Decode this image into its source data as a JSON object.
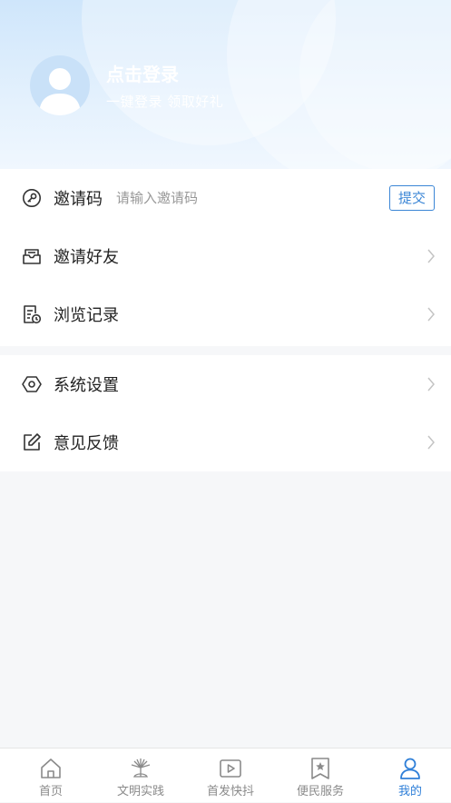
{
  "header": {
    "login_title": "点击登录",
    "login_subtitle": "一键登录 领取好礼",
    "avatar_icon": "user-avatar-icon"
  },
  "menu_section_1": {
    "invite_code": {
      "label": "邀请码",
      "placeholder": "请输入邀请码",
      "value": "",
      "submit_label": "提交",
      "icon": "key-icon"
    },
    "items": [
      {
        "label": "邀请好友",
        "icon": "inbox-icon"
      },
      {
        "label": "浏览记录",
        "icon": "history-icon"
      }
    ]
  },
  "menu_section_2": {
    "items": [
      {
        "label": "系统设置",
        "icon": "settings-hexagon-icon"
      },
      {
        "label": "意见反馈",
        "icon": "edit-icon"
      }
    ]
  },
  "tabbar": {
    "tabs": [
      {
        "label": "首页",
        "icon": "home-icon",
        "active": false
      },
      {
        "label": "文明实践",
        "icon": "emblem-icon",
        "active": false
      },
      {
        "label": "首发快抖",
        "icon": "video-play-icon",
        "active": false
      },
      {
        "label": "便民服务",
        "icon": "star-badge-icon",
        "active": false
      },
      {
        "label": "我的",
        "icon": "user-icon",
        "active": true
      }
    ]
  },
  "colors": {
    "accent": "#2f7fd8",
    "button_border": "#3b86d6",
    "inactive_tab": "#8a8a8a",
    "page_background": "#f6f7f9"
  }
}
